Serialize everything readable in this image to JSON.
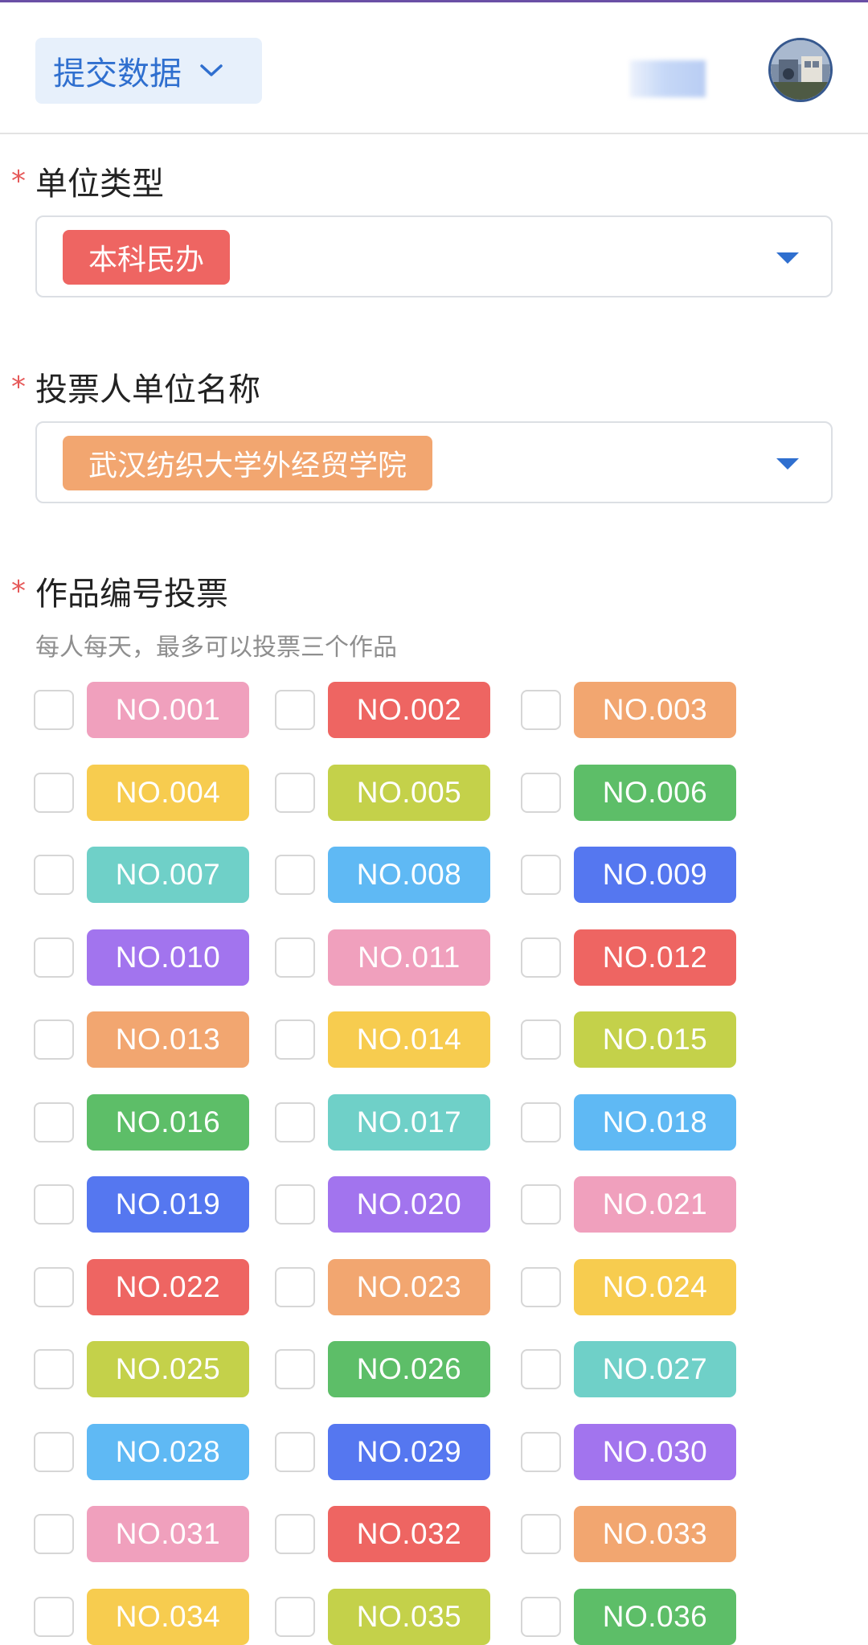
{
  "header": {
    "submit_label": "提交数据",
    "chevron_icon": "chevron-down-icon",
    "accent": "#2f6fcf"
  },
  "fields": {
    "unit_type": {
      "required_mark": "*",
      "label": "单位类型",
      "value": "本科民办",
      "chip_color": "#ee6562"
    },
    "unit_name": {
      "required_mark": "*",
      "label": "投票人单位名称",
      "value": "武汉纺织大学外经贸学院",
      "chip_color": "#f2a670"
    },
    "vote": {
      "required_mark": "*",
      "label": "作品编号投票",
      "hint": "每人每天，最多可以投票三个作品"
    }
  },
  "options": [
    {
      "label": "NO.001",
      "color": "#f0a0bd"
    },
    {
      "label": "NO.002",
      "color": "#ee6562"
    },
    {
      "label": "NO.003",
      "color": "#f2a670"
    },
    {
      "label": "NO.004",
      "color": "#f7cc4f"
    },
    {
      "label": "NO.005",
      "color": "#c4d14a"
    },
    {
      "label": "NO.006",
      "color": "#5dbe68"
    },
    {
      "label": "NO.007",
      "color": "#6fd0c8"
    },
    {
      "label": "NO.008",
      "color": "#5fb9f4"
    },
    {
      "label": "NO.009",
      "color": "#5577f0"
    },
    {
      "label": "NO.010",
      "color": "#a274ee"
    },
    {
      "label": "NO.011",
      "color": "#f0a0bd"
    },
    {
      "label": "NO.012",
      "color": "#ee6562"
    },
    {
      "label": "NO.013",
      "color": "#f2a670"
    },
    {
      "label": "NO.014",
      "color": "#f7cc4f"
    },
    {
      "label": "NO.015",
      "color": "#c4d14a"
    },
    {
      "label": "NO.016",
      "color": "#5dbe68"
    },
    {
      "label": "NO.017",
      "color": "#6fd0c8"
    },
    {
      "label": "NO.018",
      "color": "#5fb9f4"
    },
    {
      "label": "NO.019",
      "color": "#5577f0"
    },
    {
      "label": "NO.020",
      "color": "#a274ee"
    },
    {
      "label": "NO.021",
      "color": "#f0a0bd"
    },
    {
      "label": "NO.022",
      "color": "#ee6562"
    },
    {
      "label": "NO.023",
      "color": "#f2a670"
    },
    {
      "label": "NO.024",
      "color": "#f7cc4f"
    },
    {
      "label": "NO.025",
      "color": "#c4d14a"
    },
    {
      "label": "NO.026",
      "color": "#5dbe68"
    },
    {
      "label": "NO.027",
      "color": "#6fd0c8"
    },
    {
      "label": "NO.028",
      "color": "#5fb9f4"
    },
    {
      "label": "NO.029",
      "color": "#5577f0"
    },
    {
      "label": "NO.030",
      "color": "#a274ee"
    },
    {
      "label": "NO.031",
      "color": "#f0a0bd"
    },
    {
      "label": "NO.032",
      "color": "#ee6562"
    },
    {
      "label": "NO.033",
      "color": "#f2a670"
    },
    {
      "label": "NO.034",
      "color": "#f7cc4f"
    },
    {
      "label": "NO.035",
      "color": "#c4d14a"
    },
    {
      "label": "NO.036",
      "color": "#5dbe68"
    }
  ]
}
